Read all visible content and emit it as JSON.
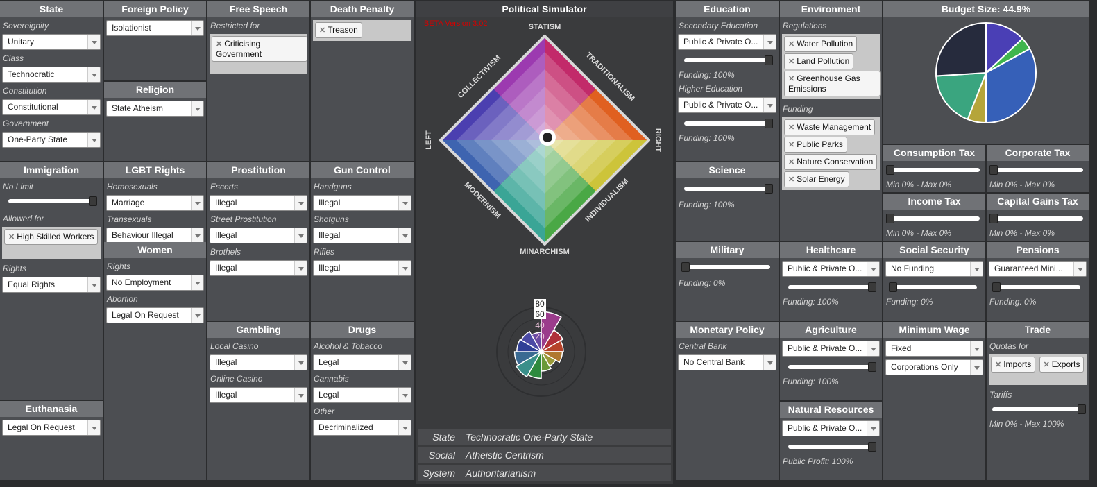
{
  "state": {
    "title": "State",
    "sovereignty_label": "Sovereignity",
    "sovereignty": "Unitary",
    "class_label": "Class",
    "class": "Technocratic",
    "constitution_label": "Constitution",
    "constitution": "Constitutional",
    "government_label": "Government",
    "government": "One-Party State"
  },
  "foreign_policy": {
    "title": "Foreign Policy",
    "value": "Isolationist"
  },
  "religion": {
    "title": "Religion",
    "value": "State Atheism"
  },
  "free_speech": {
    "title": "Free Speech",
    "restricted_label": "Restricted for",
    "restricted": [
      "Criticising Government"
    ]
  },
  "death_penalty": {
    "title": "Death Penalty",
    "tags": [
      "Treason"
    ]
  },
  "immigration": {
    "title": "Immigration",
    "limit_label": "No Limit",
    "limit_level": 1.0,
    "allowed_label": "Allowed for",
    "allowed": [
      "High Skilled Workers"
    ],
    "rights_label": "Rights",
    "rights": "Equal Rights"
  },
  "lgbt": {
    "title": "LGBT Rights",
    "homosexuals_label": "Homosexuals",
    "homosexuals": "Marriage",
    "transexuals_label": "Transexuals",
    "transexuals": "Behaviour Illegal"
  },
  "women": {
    "title": "Women",
    "rights_label": "Rights",
    "rights": "No Employment",
    "abortion_label": "Abortion",
    "abortion": "Legal On Request"
  },
  "prostitution": {
    "title": "Prostitution",
    "escorts_label": "Escorts",
    "escorts": "Illegal",
    "street_label": "Street Prostitution",
    "street": "Illegal",
    "brothels_label": "Brothels",
    "brothels": "Illegal"
  },
  "gun_control": {
    "title": "Gun Control",
    "handguns_label": "Handguns",
    "handguns": "Illegal",
    "shotguns_label": "Shotguns",
    "shotguns": "Illegal",
    "rifles_label": "Rifles",
    "rifles": "Illegal"
  },
  "gambling": {
    "title": "Gambling",
    "local_label": "Local Casino",
    "local": "Illegal",
    "online_label": "Online Casino",
    "online": "Illegal"
  },
  "drugs": {
    "title": "Drugs",
    "alcohol_label": "Alcohol & Tobacco",
    "alcohol": "Legal",
    "cannabis_label": "Cannabis",
    "cannabis": "Legal",
    "other_label": "Other",
    "other": "Decriminalized"
  },
  "euthanasia": {
    "title": "Euthanasia",
    "value": "Legal On Request"
  },
  "simulator": {
    "title": "Political Simulator",
    "beta": "BETA Version 3.02",
    "axes": {
      "top": "STATISM",
      "bottom": "MINARCHISM",
      "left": "LEFT",
      "right": "RIGHT",
      "top_left": "COLLECTIVISM",
      "top_right": "TRADITIONALISM",
      "bottom_left": "MODERNISM",
      "bottom_right": "INDIVIDUALISM"
    },
    "radial_ticks": [
      "80",
      "60",
      "40",
      "20"
    ],
    "radial_values": [
      72,
      45,
      40,
      38,
      30,
      35,
      48,
      52,
      48,
      44,
      42,
      35
    ],
    "radial_colors": [
      "#9b3c8c",
      "#b0303a",
      "#b6432a",
      "#b07830",
      "#9a9a38",
      "#6a9a38",
      "#2e8a3e",
      "#3a8f8a",
      "#3a6a92",
      "#2f3f96",
      "#4b4aa5",
      "#6a4aa2"
    ],
    "summary": [
      {
        "key": "State",
        "value": "Technocratic One-Party State"
      },
      {
        "key": "Social",
        "value": "Atheistic Centrism"
      },
      {
        "key": "System",
        "value": "Authoritarianism"
      }
    ]
  },
  "education": {
    "title": "Education",
    "secondary_label": "Secondary Education",
    "secondary": "Public & Private O...",
    "secondary_funding": "Funding: 100%",
    "secondary_level": 1.0,
    "higher_label": "Higher Education",
    "higher": "Public & Private O...",
    "higher_funding": "Funding: 100%",
    "higher_level": 1.0
  },
  "environment": {
    "title": "Environment",
    "regulations_label": "Regulations",
    "regulations": [
      "Water Pollution",
      "Land Pollution",
      "Greenhouse Gas Emissions"
    ],
    "funding_label": "Funding",
    "funding": [
      "Waste Management",
      "Public Parks",
      "Nature Conservation",
      "Solar Energy"
    ]
  },
  "budget": {
    "title": "Budget Size: 44.9%",
    "slices": [
      {
        "value": 13,
        "color": "#4a3fb5"
      },
      {
        "value": 4,
        "color": "#3fb54d"
      },
      {
        "value": 33,
        "color": "#3660b8"
      },
      {
        "value": 6,
        "color": "#b5a53a"
      },
      {
        "value": 18,
        "color": "#3aa57f"
      },
      {
        "value": 26,
        "color": "#262b3d"
      }
    ]
  },
  "science": {
    "title": "Science",
    "funding": "Funding: 100%",
    "level": 1.0
  },
  "consumption_tax": {
    "title": "Consumption Tax",
    "range": "Min 0% - Max 0%",
    "level": 0
  },
  "corporate_tax": {
    "title": "Corporate Tax",
    "range": "Min 0% - Max 0%",
    "level": 0
  },
  "income_tax": {
    "title": "Income Tax",
    "range": "Min 0% - Max 0%",
    "level": 0
  },
  "capital_gains_tax": {
    "title": "Capital Gains Tax",
    "range": "Min 0% - Max 0%",
    "level": 0
  },
  "military": {
    "title": "Military",
    "funding": "Funding: 0%",
    "level": 0
  },
  "healthcare": {
    "title": "Healthcare",
    "value": "Public & Private O...",
    "funding": "Funding: 100%",
    "level": 1.0
  },
  "social_security": {
    "title": "Social Security",
    "value": "No Funding",
    "funding": "Funding: 0%",
    "level": 0
  },
  "pensions": {
    "title": "Pensions",
    "value": "Guaranteed Mini...",
    "funding": "Funding: 0%",
    "level": 0
  },
  "monetary_policy": {
    "title": "Monetary Policy",
    "central_bank_label": "Central Bank",
    "central_bank": "No Central Bank"
  },
  "agriculture": {
    "title": "Agriculture",
    "value": "Public & Private O...",
    "funding": "Funding: 100%",
    "level": 1.0
  },
  "minimum_wage": {
    "title": "Minimum Wage",
    "type": "Fixed",
    "scope": "Corporations Only"
  },
  "trade": {
    "title": "Trade",
    "quotas_label": "Quotas for",
    "quotas": [
      "Imports",
      "Exports"
    ],
    "tariffs_label": "Tariffs",
    "tariffs_range": "Min 0% - Max 100%",
    "tariffs_level": 1.0
  },
  "natural_resources": {
    "title": "Natural Resources",
    "value": "Public & Private O...",
    "profit": "Public Profit: 100%",
    "level": 1.0
  }
}
